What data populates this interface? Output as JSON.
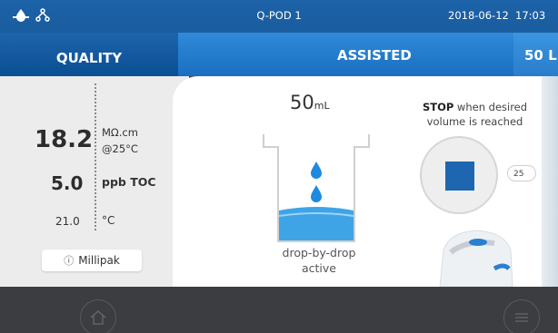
{
  "status_bar": {
    "device_name": "Q-POD 1",
    "date": "2018-06-12",
    "time": "17:03",
    "icons": [
      "water-drop-icon",
      "network-icon"
    ]
  },
  "tabs": [
    {
      "label": "QUALITY",
      "selected": false
    },
    {
      "label": "ASSISTED",
      "selected": true
    },
    {
      "label": "50 L",
      "selected": false
    }
  ],
  "quality": {
    "resistivity_value": "18.2",
    "resistivity_unit": "MΩ.cm",
    "resistivity_ref": "@25°C",
    "toc_value": "5.0",
    "toc_unit": "ppb TOC",
    "temperature_value": "21.0",
    "temperature_unit": "°C",
    "purification_pack": "Millipak"
  },
  "dispense": {
    "volume_value": "50",
    "volume_unit": "mL",
    "mode_line1": "drop-by-drop",
    "mode_line2": "active",
    "stop_bold": "STOP",
    "stop_rest": " when desired volume is reached",
    "indicator": "25"
  },
  "colors": {
    "brand_blue": "#1a5d9f",
    "tab_active": "#2f8ad8",
    "stop_square": "#1e66b0"
  },
  "bottom": {
    "home_icon": "home-icon",
    "menu_icon": "menu-icon"
  }
}
